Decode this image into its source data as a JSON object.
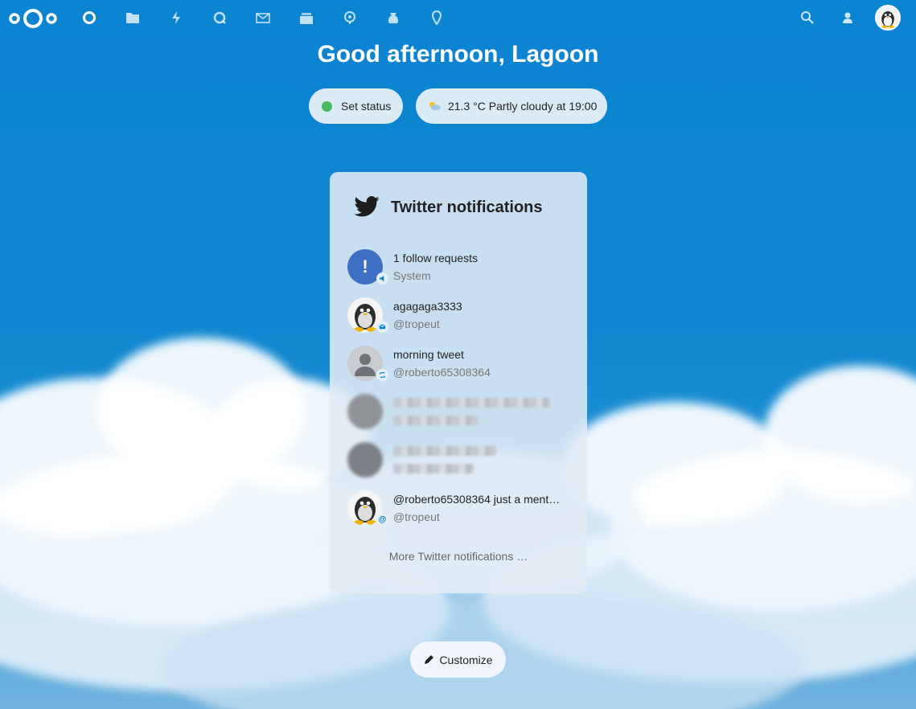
{
  "header": {
    "nav_icons": [
      "dashboard-icon",
      "files-icon",
      "activity-icon",
      "talk-icon",
      "mail-icon",
      "deck-icon",
      "maps-icon",
      "cospend-icon",
      "location-icon"
    ],
    "right_icons": [
      "search-icon",
      "contacts-icon",
      "user-avatar"
    ]
  },
  "greeting": "Good afternoon, Lagoon",
  "status": {
    "label": "Set status",
    "dot_color": "#46ba61"
  },
  "weather": {
    "label": "21.3 °C Partly cloudy at 19:00",
    "icon": "partly-cloudy-icon"
  },
  "widget": {
    "title": "Twitter notifications",
    "icon": "twitter-icon",
    "items": [
      {
        "title": "1 follow requests",
        "subtitle": "System",
        "avatar": "alert-icon",
        "badge": "megaphone-icon"
      },
      {
        "title": "agagaga3333",
        "subtitle": "@tropeut",
        "avatar": "penguin-avatar",
        "badge": "message-icon"
      },
      {
        "title": "morning tweet",
        "subtitle": "@roberto65308364",
        "avatar": "default-user-avatar",
        "badge": "retweet-icon"
      },
      {
        "title": "",
        "subtitle": "",
        "avatar": "blurred-avatar",
        "badge": ""
      },
      {
        "title": "",
        "subtitle": "",
        "avatar": "blurred-avatar",
        "badge": ""
      },
      {
        "title": "@roberto65308364 just a ment…",
        "subtitle": "@tropeut",
        "avatar": "penguin-avatar",
        "badge": "mention-icon"
      }
    ],
    "more_label": "More Twitter notifications …"
  },
  "customize": {
    "label": "Customize",
    "icon": "pencil-icon"
  },
  "colors": {
    "background": "#0b84d2",
    "twitter_blue": "#1d1d1d",
    "alert_avatar": "#3d6fc5"
  }
}
